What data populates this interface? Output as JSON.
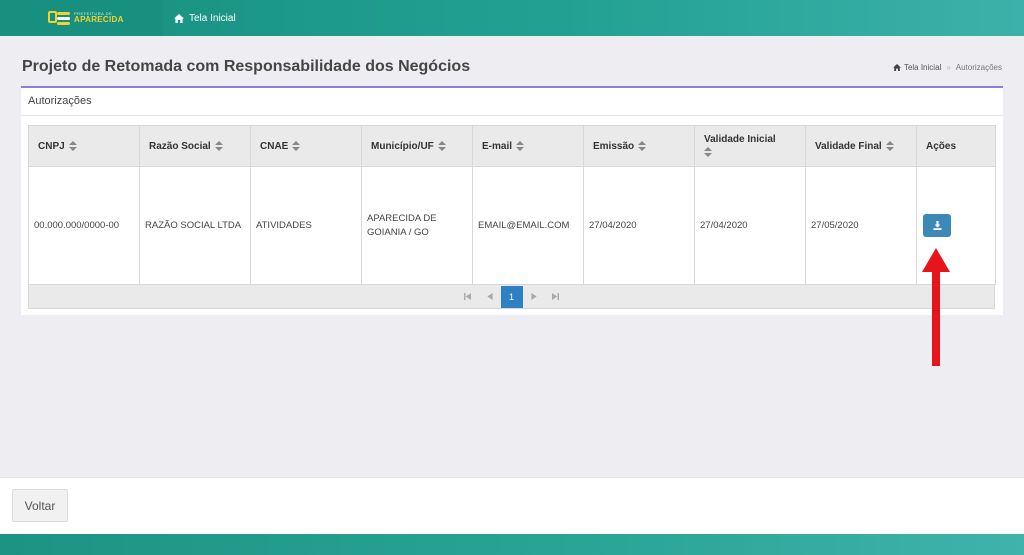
{
  "logo": {
    "small_text": "PREFEITURA DE",
    "big_text": "APARECIDA"
  },
  "nav": {
    "home_label": "Tela Inicial"
  },
  "page": {
    "title": "Projeto de Retomada com Responsabilidade dos Negócios"
  },
  "breadcrumb": {
    "home": "Tela Inicial",
    "separator": "»",
    "current": "Autorizações"
  },
  "panel": {
    "title": "Autorizações"
  },
  "table": {
    "columns": [
      "CNPJ",
      "Razão Social",
      "CNAE",
      "Município/UF",
      "E-mail",
      "Emissão",
      "Validade Inicial",
      "Validade Final",
      "Ações"
    ],
    "rows": [
      {
        "cnpj": "00.000.000/0000-00",
        "razao_social": "RAZÃO SOCIAL LTDA",
        "cnae": "ATIVIDADES",
        "municipio_line1": "APARECIDA DE",
        "municipio_line2": "GOIANIA / GO",
        "email": "EMAIL@EMAIL.COM",
        "emissao": "27/04/2020",
        "validade_inicial": "27/04/2020",
        "validade_final": "27/05/2020"
      }
    ]
  },
  "pagination": {
    "current_page": "1"
  },
  "footer": {
    "back_label": "Voltar"
  },
  "colors": {
    "accent": "#22a192",
    "download_button": "#3c89b8",
    "annotation_arrow": "#e8141b",
    "panel_top_border": "#8a7ce0"
  },
  "icons": {
    "home": "home-icon",
    "download": "download-icon",
    "sort": "sort-icon"
  }
}
